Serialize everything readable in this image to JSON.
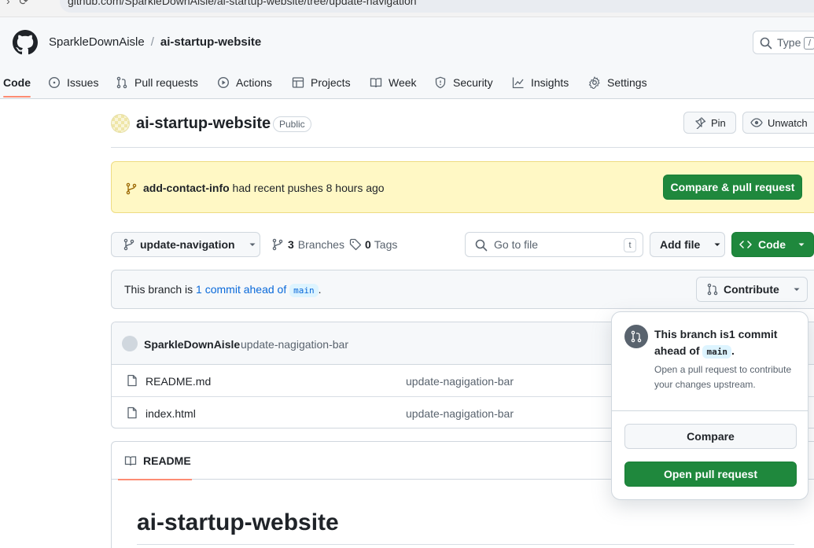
{
  "browser": {
    "url": "github.com/SparkleDownAisle/ai-startup-website/tree/update-navigation"
  },
  "header": {
    "owner": "SparkleDownAisle",
    "separator": "/",
    "repo": "ai-startup-website",
    "search_placeholder": "Type",
    "search_shortcut": "/"
  },
  "tabs": [
    {
      "label": "Code",
      "icon": "code-icon",
      "active": true
    },
    {
      "label": "Issues",
      "icon": "issue-icon"
    },
    {
      "label": "Pull requests",
      "icon": "pull-request-icon"
    },
    {
      "label": "Actions",
      "icon": "play-icon"
    },
    {
      "label": "Projects",
      "icon": "table-icon"
    },
    {
      "label": "Week",
      "icon": "book-icon"
    },
    {
      "label": "Security",
      "icon": "shield-icon"
    },
    {
      "label": "Insights",
      "icon": "graph-icon"
    },
    {
      "label": "Settings",
      "icon": "gear-icon"
    }
  ],
  "repo_header": {
    "title": "ai-startup-website",
    "visibility": "Public",
    "pin_label": "Pin",
    "unwatch_label": "Unwatch"
  },
  "push_banner": {
    "branch": "add-contact-info",
    "text": " had recent pushes 8 hours ago",
    "button": "Compare & pull request"
  },
  "toolbar": {
    "branch": "update-navigation",
    "branches_count": "3",
    "branches_label": "Branches",
    "tags_count": "0",
    "tags_label": "Tags",
    "goto_placeholder": "Go to file",
    "goto_shortcut": "t",
    "add_file": "Add file",
    "code": "Code"
  },
  "ahead_bar": {
    "prefix": "This branch is ",
    "link": "1 commit ahead of",
    "base": "main",
    "suffix": ".",
    "contribute": "Contribute"
  },
  "files": {
    "latest_author": "SparkleDownAisle",
    "latest_message": "update-nagigation-bar",
    "rows": [
      {
        "name": "README.md",
        "message": "update-nagigation-bar"
      },
      {
        "name": "index.html",
        "message": "update-nagigation-bar"
      }
    ]
  },
  "readme": {
    "tab": "README",
    "heading": "ai-startup-website"
  },
  "popover": {
    "title_prefix": "This branch is1 commit ahead of ",
    "base": "main",
    "title_suffix": ".",
    "description": "Open a pull request to contribute your changes upstream.",
    "compare": "Compare",
    "open_pr": "Open pull request"
  },
  "colors": {
    "green": "#1f883d",
    "link": "#0969da",
    "banner": "#fff8c5",
    "tab_underline": "#fd8c73"
  }
}
